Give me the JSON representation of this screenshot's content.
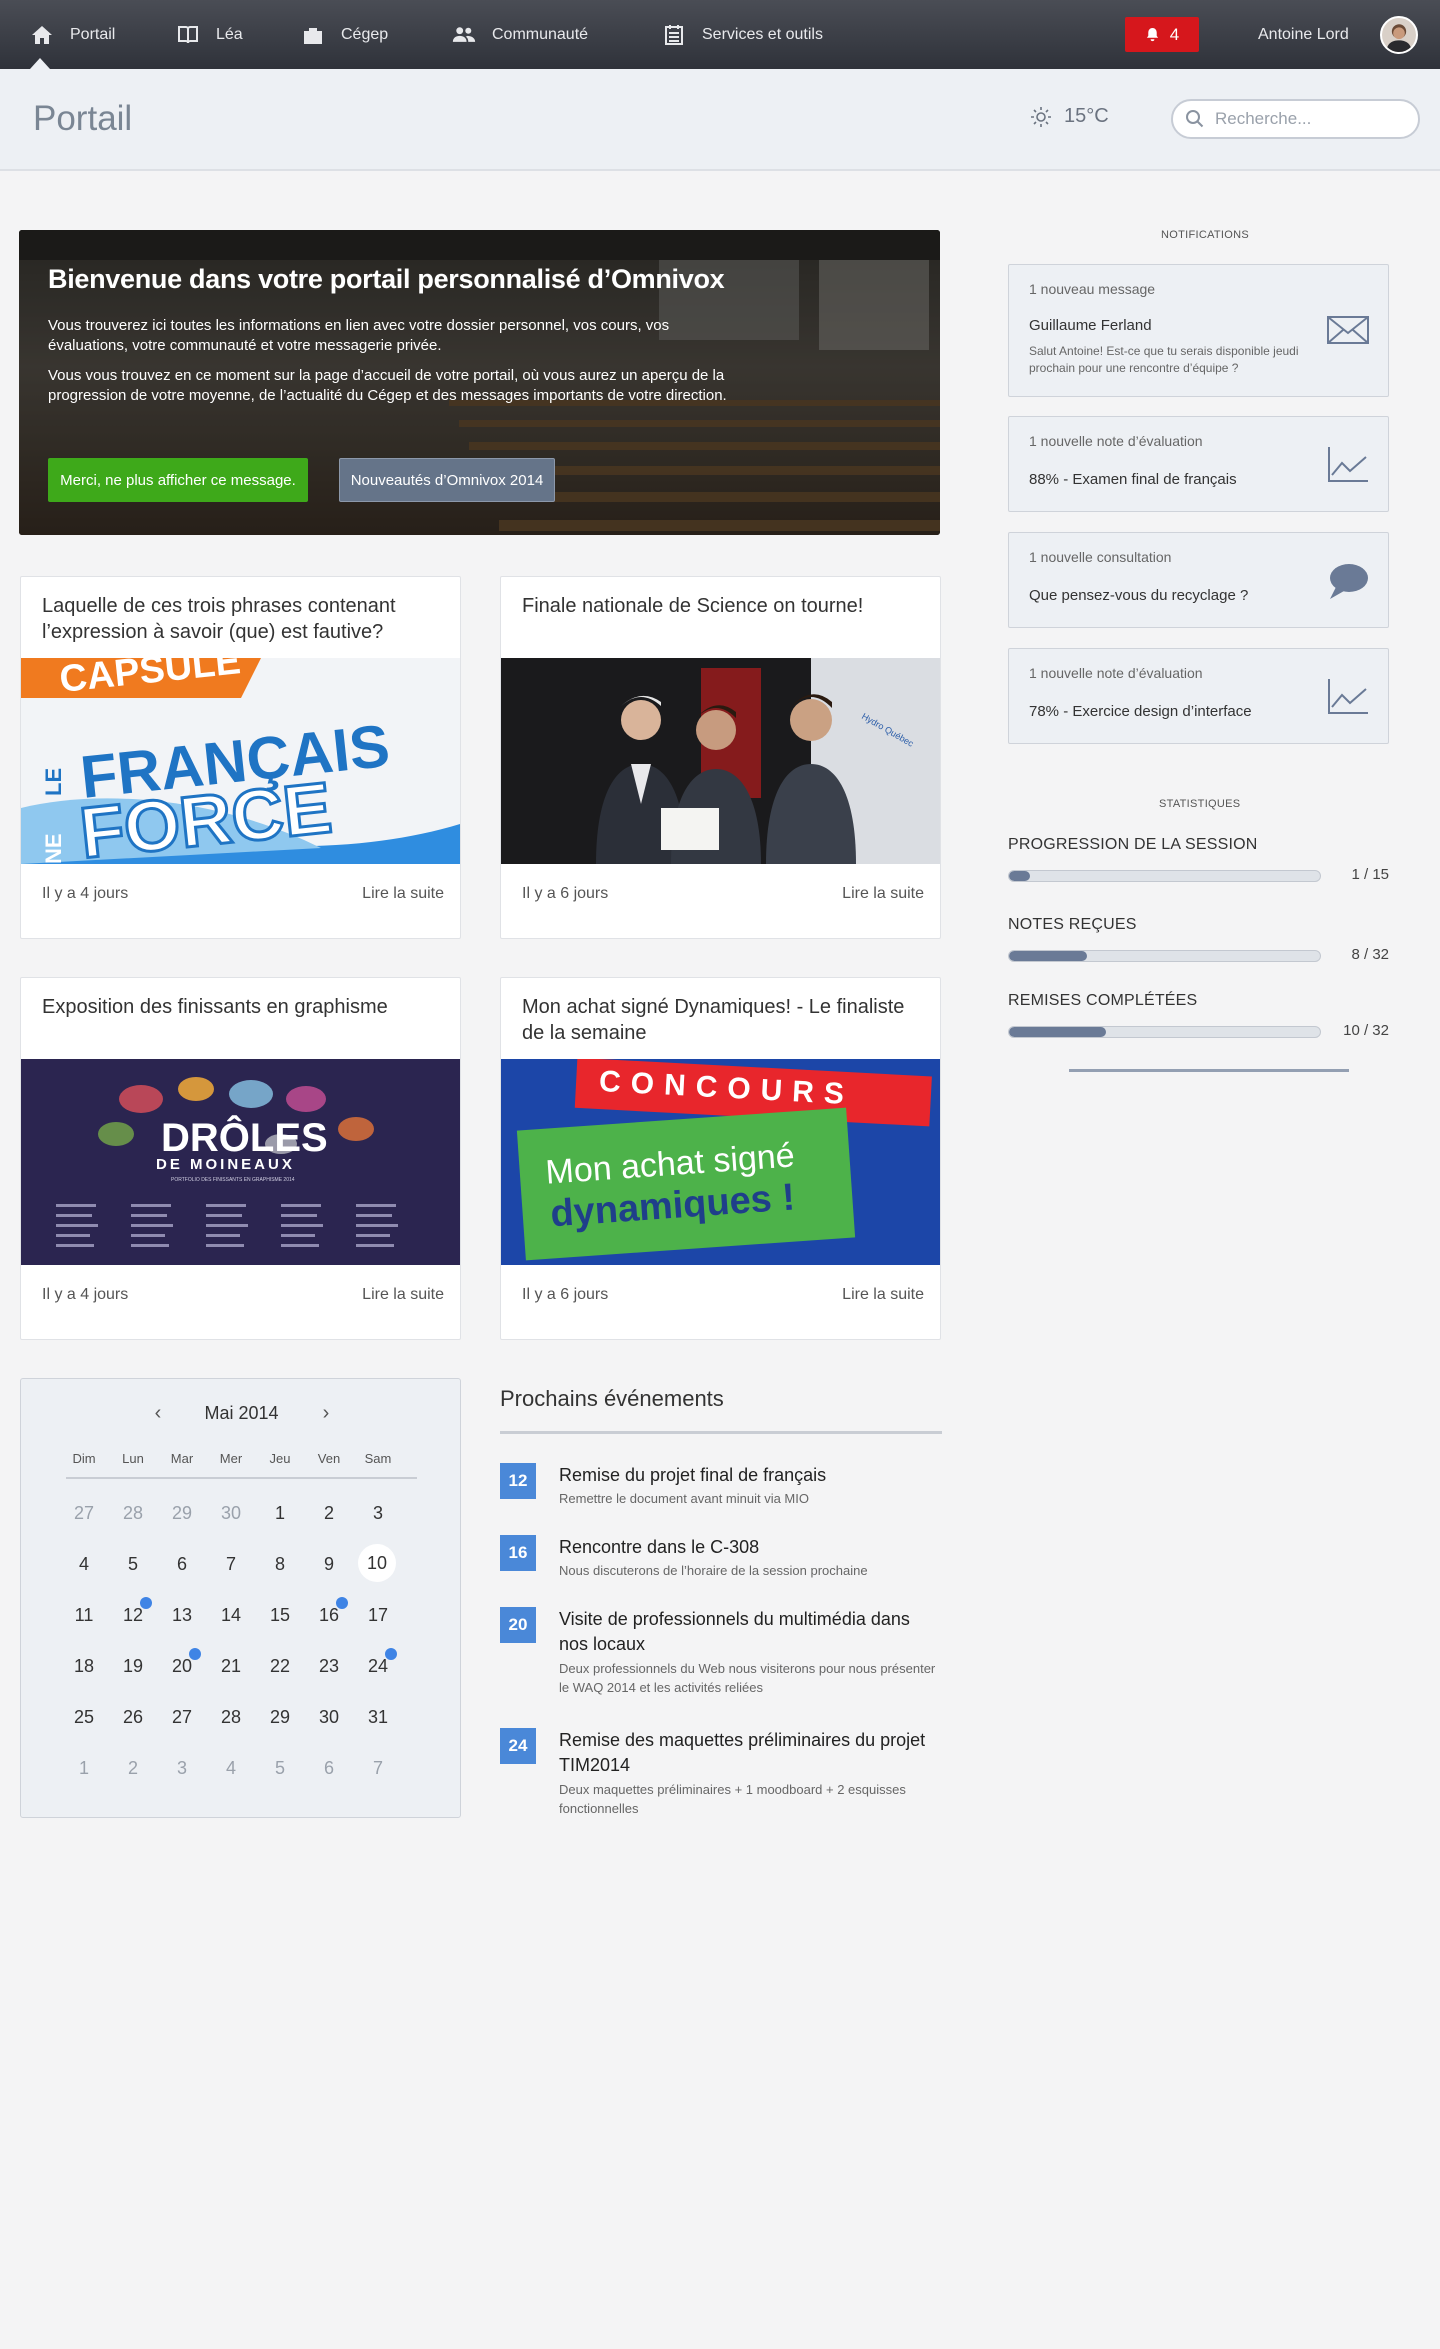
{
  "nav": {
    "items": [
      {
        "label": "Portail",
        "icon": "home-icon"
      },
      {
        "label": "Léa",
        "icon": "book-icon"
      },
      {
        "label": "Cégep",
        "icon": "building-icon"
      },
      {
        "label": "Communauté",
        "icon": "people-icon"
      },
      {
        "label": "Services et outils",
        "icon": "calendar-list-icon"
      }
    ],
    "notification_count": "4",
    "user_name": "Antoine Lord",
    "accent_color": "#d6171c"
  },
  "header": {
    "title": "Portail",
    "weather": "15°C",
    "search_placeholder": "Recherche..."
  },
  "hero": {
    "title": "Bienvenue dans votre portail personnalisé d’Omnivox",
    "p1": "Vous trouverez ici toutes les informations en lien avec votre dossier personnel, vos cours, vos évaluations, votre communauté et votre messagerie privée.",
    "p2": "Vous vous trouvez en ce moment sur la page d’accueil de votre portail, où vous aurez un aperçu de la progression de votre moyenne, de l’actualité du Cégep et des messages importants de votre direction.",
    "btn_hide": "Merci, ne plus afficher ce message.",
    "btn_news": "Nouveautés d’Omnivox 2014"
  },
  "news": [
    {
      "title": "Laquelle de ces trois phrases contenant l’expression à savoir (que) est fautive?",
      "date": "Il y a 4 jours",
      "more": "Lire la suite",
      "image": {
        "line1": "CAPSULE",
        "line2": "LE",
        "line3": "FRANÇAIS",
        "line4": "NE",
        "line5": "FORCE"
      }
    },
    {
      "title": "Finale nationale de Science on tourne!",
      "date": "Il y a 6 jours",
      "more": "Lire la suite",
      "image": {
        "logo": "Hydro Québec"
      }
    },
    {
      "title": "Exposition des finissants en graphisme",
      "date": "Il y a 4 jours",
      "more": "Lire la suite",
      "image": {
        "line1": "DRÔLES",
        "line2": "DE MOINEAUX",
        "line3": "PORTFOLIO DES FINISSANTS EN GRAPHISME 2014"
      }
    },
    {
      "title": "Mon achat signé Dynamiques! - Le finaliste de la semaine",
      "date": "Il y a 6 jours",
      "more": "Lire la suite",
      "image": {
        "line1": "CONCOURS",
        "line2": "Mon achat signé",
        "line3": "dynamiques !"
      }
    }
  ],
  "calendar": {
    "month": "Mai 2014",
    "dow": [
      "Dim",
      "Lun",
      "Mar",
      "Mer",
      "Jeu",
      "Ven",
      "Sam"
    ],
    "weeks": [
      [
        "27",
        "28",
        "29",
        "30",
        "1",
        "2",
        "3"
      ],
      [
        "4",
        "5",
        "6",
        "7",
        "8",
        "9",
        "10"
      ],
      [
        "11",
        "12",
        "13",
        "14",
        "15",
        "16",
        "17"
      ],
      [
        "18",
        "19",
        "20",
        "21",
        "22",
        "23",
        "24"
      ],
      [
        "25",
        "26",
        "27",
        "28",
        "29",
        "30",
        "31"
      ],
      [
        "1",
        "2",
        "3",
        "4",
        "5",
        "6",
        "7"
      ]
    ],
    "today": "10",
    "event_days": [
      "12",
      "16",
      "20",
      "24"
    ]
  },
  "events": {
    "title": "Prochains événements",
    "items": [
      {
        "day": "12",
        "title": "Remise du projet final de français",
        "desc": "Remettre le document avant minuit via MIO"
      },
      {
        "day": "16",
        "title": "Rencontre dans le C-308",
        "desc": "Nous discuterons de l’horaire de la session prochaine"
      },
      {
        "day": "20",
        "title": "Visite de professionnels du multimédia dans nos locaux",
        "desc": "Deux professionnels du Web nous visiterons pour nous présenter le WAQ 2014 et les activités reliées"
      },
      {
        "day": "24",
        "title": "Remise des maquettes préliminaires du projet TIM2014",
        "desc": "Deux maquettes préliminaires + 1 moodboard + 2 esquisses fonctionnelles"
      }
    ]
  },
  "notifications": {
    "label": "NOTIFICATIONS",
    "items": [
      {
        "head": "1 nouveau message",
        "body": "Guillaume Ferland",
        "sub": "Salut Antoine! Est-ce que tu serais disponible jeudi prochain pour une rencontre d’équipe ?",
        "icon": "envelope-icon"
      },
      {
        "head": "1 nouvelle note d’évaluation",
        "body": "88% - Examen final de français",
        "icon": "chart-icon"
      },
      {
        "head": "1 nouvelle consultation",
        "body": "Que pensez-vous du recyclage ?",
        "icon": "speech-bubble-icon"
      },
      {
        "head": "1 nouvelle note d’évaluation",
        "body": "78% - Exercice design d’interface",
        "icon": "chart-icon"
      }
    ]
  },
  "stats": {
    "label": "STATISTIQUES",
    "items": [
      {
        "label": "PROGRESSION DE LA SESSION",
        "value": "1 / 15",
        "progress": 0.067
      },
      {
        "label": "NOTES REÇUES",
        "value": "8 / 32",
        "progress": 0.25
      },
      {
        "label": "REMISES COMPLÉTÉES",
        "value": "10 / 32",
        "progress": 0.3125
      }
    ]
  }
}
